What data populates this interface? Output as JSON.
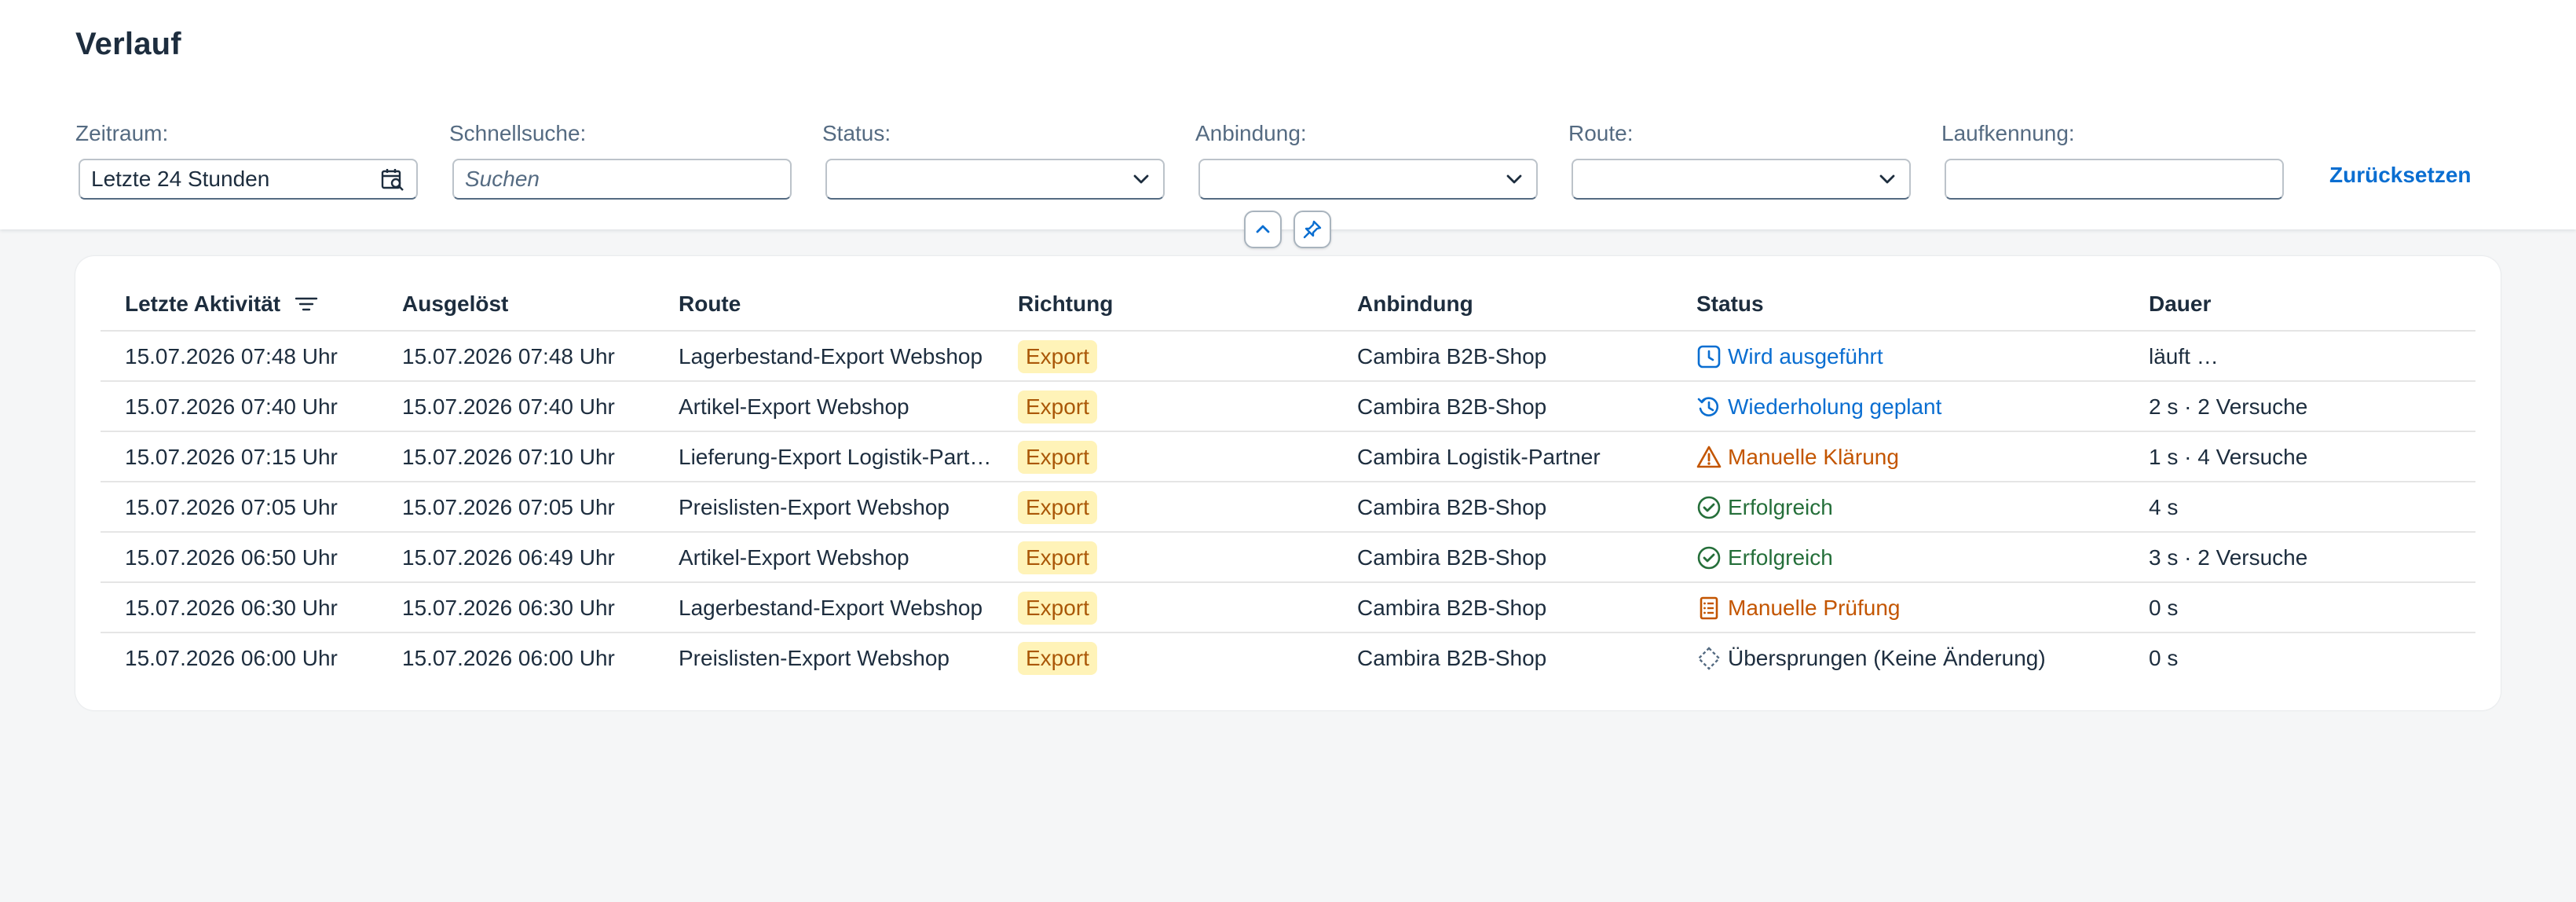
{
  "page": {
    "title": "Verlauf"
  },
  "filters": {
    "zeitraum": {
      "label": "Zeitraum:",
      "value": "Letzte 24 Stunden"
    },
    "schnellsuche": {
      "label": "Schnellsuche:",
      "placeholder": "Suchen"
    },
    "status": {
      "label": "Status:",
      "value": ""
    },
    "anbindung": {
      "label": "Anbindung:",
      "value": ""
    },
    "route": {
      "label": "Route:",
      "value": ""
    },
    "laufkennung": {
      "label": "Laufkennung:",
      "value": ""
    },
    "reset_label": "Zurücksetzen"
  },
  "table": {
    "columns": {
      "letzte_aktivitaet": "Letzte Aktivität",
      "ausgeloest": "Ausgelöst",
      "route": "Route",
      "richtung": "Richtung",
      "anbindung": "Anbindung",
      "status": "Status",
      "dauer": "Dauer"
    },
    "rows": [
      {
        "letzte": "15.07.2026 07:48 Uhr",
        "ausgeloest": "15.07.2026 07:48 Uhr",
        "route": "Lagerbestand-Export Webshop",
        "richtung": "Export",
        "anbindung": "Cambira B2B-Shop",
        "status": "Wird ausgeführt",
        "status_type": "running",
        "dauer": "läuft …"
      },
      {
        "letzte": "15.07.2026 07:40 Uhr",
        "ausgeloest": "15.07.2026 07:40 Uhr",
        "route": "Artikel-Export Webshop",
        "richtung": "Export",
        "anbindung": "Cambira B2B-Shop",
        "status": "Wiederholung geplant",
        "status_type": "retry",
        "dauer": "2 s · 2 Versuche"
      },
      {
        "letzte": "15.07.2026 07:15 Uhr",
        "ausgeloest": "15.07.2026 07:10 Uhr",
        "route": "Lieferung-Export Logistik-Part…",
        "richtung": "Export",
        "anbindung": "Cambira Logistik-Partner",
        "status": "Manuelle Klärung",
        "status_type": "warning",
        "dauer": "1 s · 4 Versuche"
      },
      {
        "letzte": "15.07.2026 07:05 Uhr",
        "ausgeloest": "15.07.2026 07:05 Uhr",
        "route": "Preislisten-Export Webshop",
        "richtung": "Export",
        "anbindung": "Cambira B2B-Shop",
        "status": "Erfolgreich",
        "status_type": "success",
        "dauer": "4 s"
      },
      {
        "letzte": "15.07.2026 06:50 Uhr",
        "ausgeloest": "15.07.2026 06:49 Uhr",
        "route": "Artikel-Export Webshop",
        "richtung": "Export",
        "anbindung": "Cambira B2B-Shop",
        "status": "Erfolgreich",
        "status_type": "success",
        "dauer": "3 s · 2 Versuche"
      },
      {
        "letzte": "15.07.2026 06:30 Uhr",
        "ausgeloest": "15.07.2026 06:30 Uhr",
        "route": "Lagerbestand-Export Webshop",
        "richtung": "Export",
        "anbindung": "Cambira B2B-Shop",
        "status": "Manuelle Prüfung",
        "status_type": "review",
        "dauer": "0 s"
      },
      {
        "letzte": "15.07.2026 06:00 Uhr",
        "ausgeloest": "15.07.2026 06:00 Uhr",
        "route": "Preislisten-Export Webshop",
        "richtung": "Export",
        "anbindung": "Cambira B2B-Shop",
        "status": "Übersprungen (Keine Änderung)",
        "status_type": "skipped",
        "dauer": "0 s"
      }
    ]
  },
  "colors": {
    "accent": "#0a6ed1",
    "warning": "#c35500",
    "success": "#256f3a",
    "badge_bg": "#fff3b8",
    "badge_text": "#aa5808"
  },
  "icons": {
    "calendar": "calendar-search-icon",
    "chevron": "chevron-down-icon",
    "collapse": "chevron-up-icon",
    "pin": "pin-icon",
    "sort": "sort-lines-icon",
    "running": "clock-icon",
    "retry": "history-icon",
    "warning": "warning-triangle-icon",
    "success": "check-circle-icon",
    "review": "document-list-icon",
    "skipped": "dashed-diamond-icon"
  }
}
